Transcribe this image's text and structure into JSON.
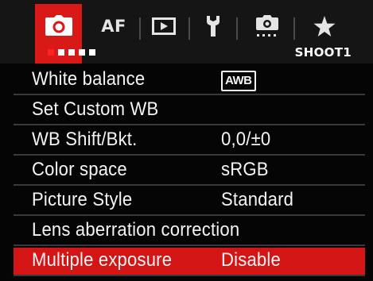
{
  "tabs": [
    {
      "id": "shoot",
      "icon": "camera-icon",
      "active": true
    },
    {
      "id": "af",
      "label": "AF"
    },
    {
      "id": "playback",
      "icon": "play-icon"
    },
    {
      "id": "setup",
      "icon": "wrench-icon"
    },
    {
      "id": "custom-functions",
      "icon": "camera-dots-icon"
    },
    {
      "id": "my-menu",
      "icon": "star-icon"
    }
  ],
  "page_indicator": {
    "label": "SHOOT1",
    "dots": 5,
    "current": 1
  },
  "menu_items": [
    {
      "label": "White balance",
      "value": "AWB",
      "value_style": "badge"
    },
    {
      "label": "Set Custom WB",
      "value": ""
    },
    {
      "label": "WB Shift/Bkt.",
      "value": "0,0/±0"
    },
    {
      "label": "Color space",
      "value": "sRGB"
    },
    {
      "label": "Picture Style",
      "value": "Standard"
    },
    {
      "label": "Lens aberration correction",
      "value": ""
    },
    {
      "label": "Multiple exposure",
      "value": "Disable",
      "selected": true
    }
  ],
  "colors": {
    "accent": "#d91818",
    "background": "#050505",
    "text": "#f4f4f4",
    "page_dot_current": "#ff2020"
  }
}
